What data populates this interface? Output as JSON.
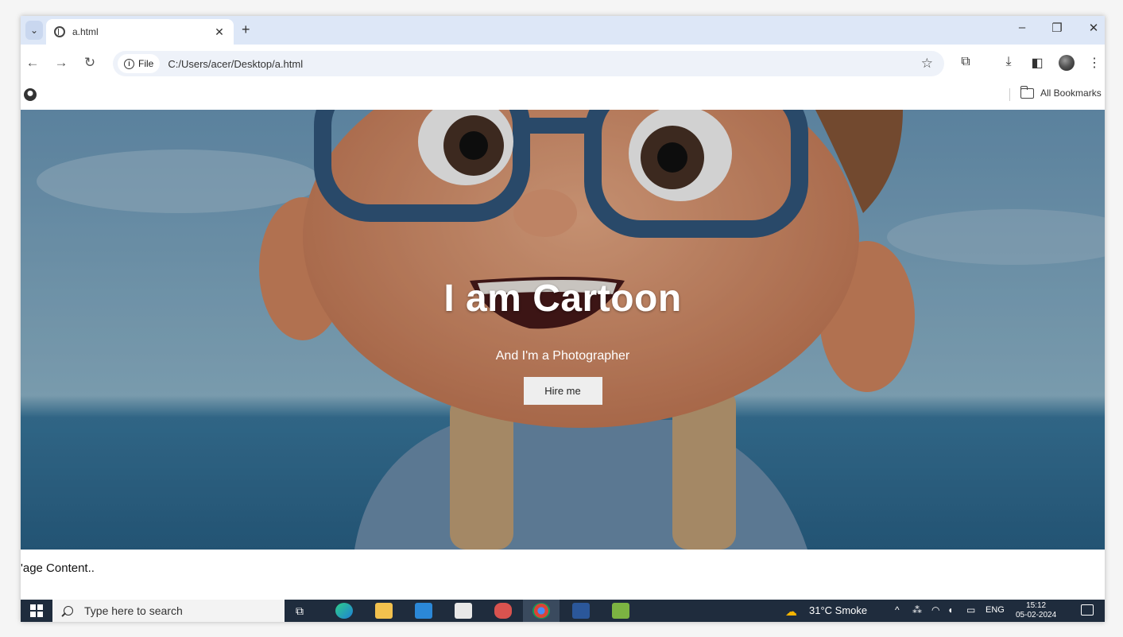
{
  "browser": {
    "tab_title": "a.html",
    "tab_close": "✕",
    "new_tab": "+",
    "window_controls": {
      "minimize": "–",
      "restore": "❐",
      "close": "✕"
    },
    "address": {
      "chip_label": "File",
      "url": "C:/Users/acer/Desktop/a.html"
    },
    "bookmarks": {
      "all_label": "All Bookmarks"
    }
  },
  "page": {
    "hero": {
      "title": "I am Cartoon",
      "subtitle": "And I'm a Photographer",
      "button_label": "Hire me"
    },
    "content_text": "'age Content.."
  },
  "taskbar": {
    "search_placeholder": "Type here to search",
    "weather": "31°C  Smoke",
    "language": "ENG",
    "time": "15:12",
    "date": "05-02-2024"
  }
}
